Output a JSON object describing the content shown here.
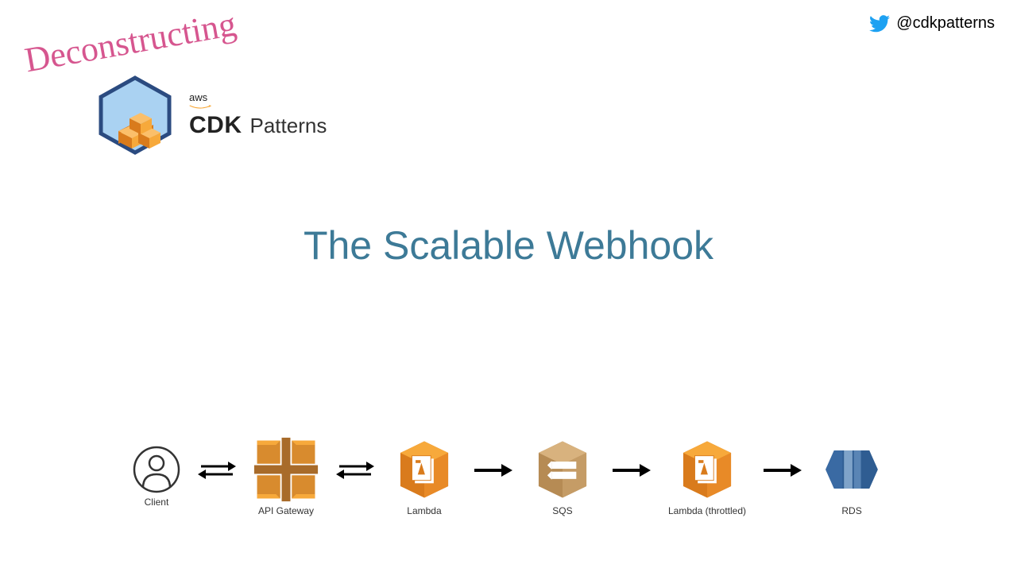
{
  "twitter": {
    "handle": "@cdkpatterns"
  },
  "header": {
    "tagline": "Deconstructing",
    "aws_label": "aws",
    "cdk": "CDK",
    "patterns": "Patterns"
  },
  "title": "The Scalable Webhook",
  "flow": {
    "nodes": {
      "client": "Client",
      "api_gateway": "API Gateway",
      "lambda1": "Lambda",
      "sqs": "SQS",
      "lambda2": "Lambda (throttled)",
      "rds": "RDS"
    },
    "arrows": [
      {
        "from": "client",
        "to": "api_gateway",
        "bidirectional": true
      },
      {
        "from": "api_gateway",
        "to": "lambda1",
        "bidirectional": true
      },
      {
        "from": "lambda1",
        "to": "sqs",
        "bidirectional": false
      },
      {
        "from": "sqs",
        "to": "lambda2",
        "bidirectional": false
      },
      {
        "from": "lambda2",
        "to": "rds",
        "bidirectional": false
      }
    ]
  },
  "colors": {
    "accent_text": "#3d7a97",
    "tagline_pink": "#d6568f",
    "aws_orange_light": "#f7a93b",
    "aws_orange_dark": "#d97b1c",
    "sqs_tan": "#caa06a",
    "rds_blue": "#3f6aa0",
    "cdk_hex_border": "#2b4b80",
    "cdk_hex_fill": "#aad2f2",
    "twitter_blue": "#1da1f2"
  }
}
